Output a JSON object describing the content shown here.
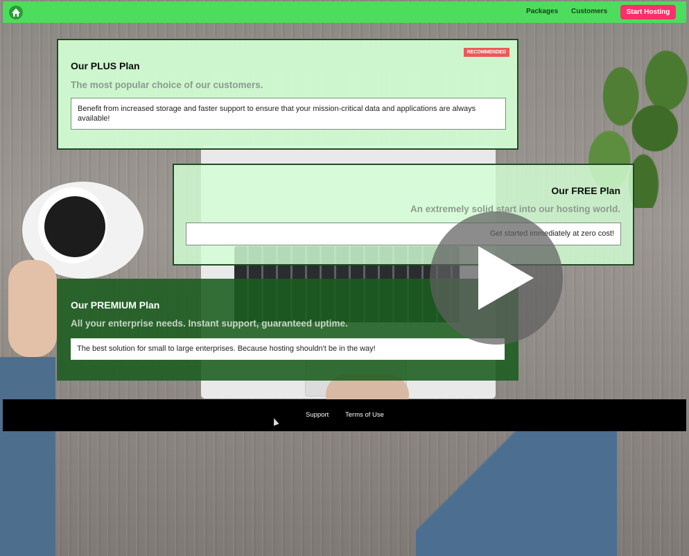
{
  "header": {
    "logo_icon": "house-logo-icon",
    "nav": [
      {
        "label": "Packages"
      },
      {
        "label": "Customers"
      }
    ],
    "cta_label": "Start Hosting"
  },
  "plans": {
    "plus": {
      "badge": "RECOMMENDED",
      "title": "Our PLUS Plan",
      "subtitle": "The most popular choice of our customers.",
      "description": "Benefit from increased storage and faster support to ensure that your mission-critical data and applications are always available!"
    },
    "free": {
      "title": "Our FREE Plan",
      "subtitle": "An extremely solid start into our hosting world.",
      "description": "Get started immediately at zero cost!"
    },
    "premium": {
      "title": "Our PREMIUM Plan",
      "subtitle": "All your enterprise needs. Instant support, guaranteed uptime.",
      "description": "The best solution for small to large enterprises. Because hosting shouldn't be in the way!"
    }
  },
  "video": {
    "play_icon": "play-icon"
  },
  "footer": {
    "links": [
      {
        "label": "Support"
      },
      {
        "label": "Terms of Use"
      }
    ]
  },
  "colors": {
    "nav_bg": "#4cdd5c",
    "cta_bg": "#ff2e6a",
    "badge_bg": "#ec5959",
    "premium_bg": "#1a5c1e",
    "plan_bg": "#d3ffd4",
    "footer_bg": "#000000"
  }
}
